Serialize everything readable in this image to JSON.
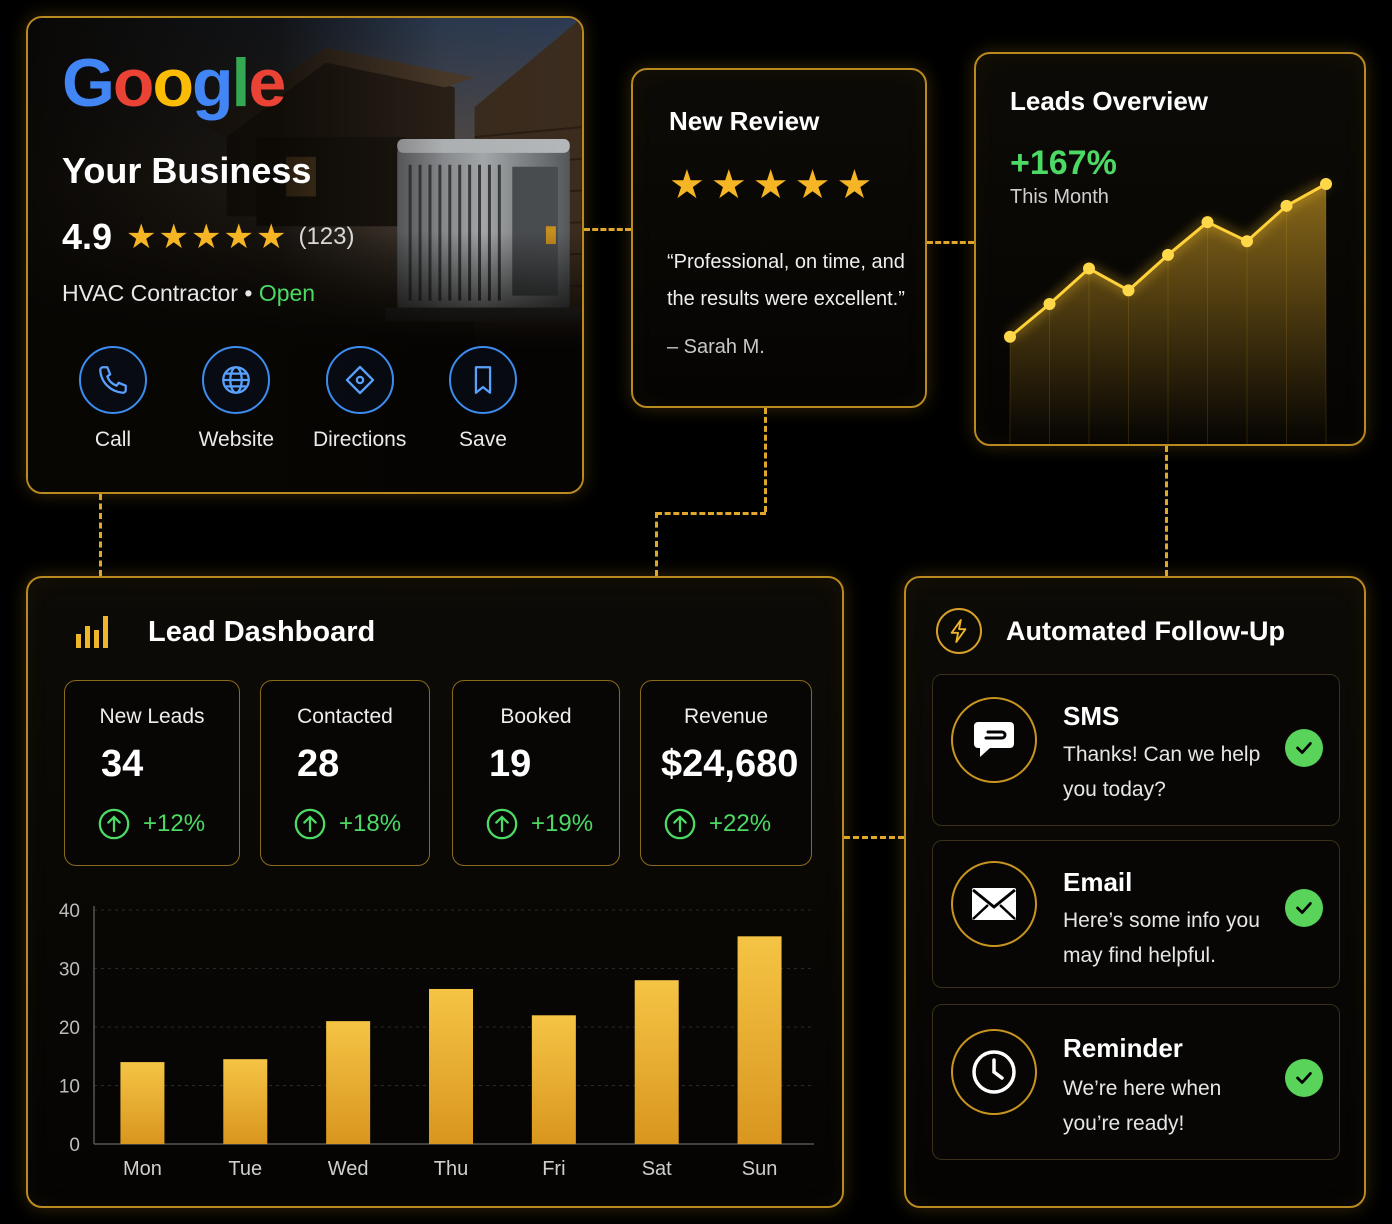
{
  "business": {
    "logo_text": "Google",
    "name": "Your Business",
    "rating": "4.9",
    "stars": "★★★★★",
    "review_count": "(123)",
    "category": "HVAC Contractor",
    "separator": "•",
    "status": "Open",
    "actions": [
      {
        "label": "Call",
        "icon": "phone-icon"
      },
      {
        "label": "Website",
        "icon": "globe-icon"
      },
      {
        "label": "Directions",
        "icon": "directions-icon"
      },
      {
        "label": "Save",
        "icon": "bookmark-icon"
      }
    ]
  },
  "review": {
    "title": "New Review",
    "stars": "★★★★★",
    "quote": "“Professional, on time, and the results were excellent.”",
    "author": "– Sarah M."
  },
  "leads_overview": {
    "title": "Leads Overview",
    "change": "+167%",
    "period": "This Month",
    "trend": [
      10,
      22,
      35,
      27,
      40,
      52,
      45,
      58,
      66
    ]
  },
  "dashboard": {
    "title": "Lead Dashboard",
    "stats": [
      {
        "label": "New Leads",
        "value": "34",
        "delta": "+12%"
      },
      {
        "label": "Contacted",
        "value": "28",
        "delta": "+18%"
      },
      {
        "label": "Booked",
        "value": "19",
        "delta": "+19%"
      },
      {
        "label": "Revenue",
        "value": "$24,680",
        "delta": "+22%"
      }
    ]
  },
  "chart_data": {
    "type": "bar",
    "categories": [
      "Mon",
      "Tue",
      "Wed",
      "Thu",
      "Fri",
      "Sat",
      "Sun"
    ],
    "values": [
      14,
      14.5,
      21,
      26.5,
      22,
      28,
      35.5
    ],
    "ylim": [
      0,
      40
    ],
    "yticks": [
      "0",
      "10",
      "20",
      "30",
      "40"
    ],
    "grid": true
  },
  "follow_up": {
    "title": "Automated Follow-Up",
    "items": [
      {
        "name": "SMS",
        "message": "Thanks! Can we help you today?",
        "icon": "chat-icon"
      },
      {
        "name": "Email",
        "message": "Here’s some info you may find helpful.",
        "icon": "envelope-icon"
      },
      {
        "name": "Reminder",
        "message": "We’re here when you’re ready!",
        "icon": "clock-icon"
      }
    ]
  },
  "colors": {
    "accent_gold": "#f0b62a",
    "border_gold": "#b98a1f",
    "positive_green": "#4cd964",
    "google_blue": "#4285f4",
    "google_red": "#ea4335",
    "google_yellow": "#fbbc05",
    "google_green": "#34a853"
  }
}
